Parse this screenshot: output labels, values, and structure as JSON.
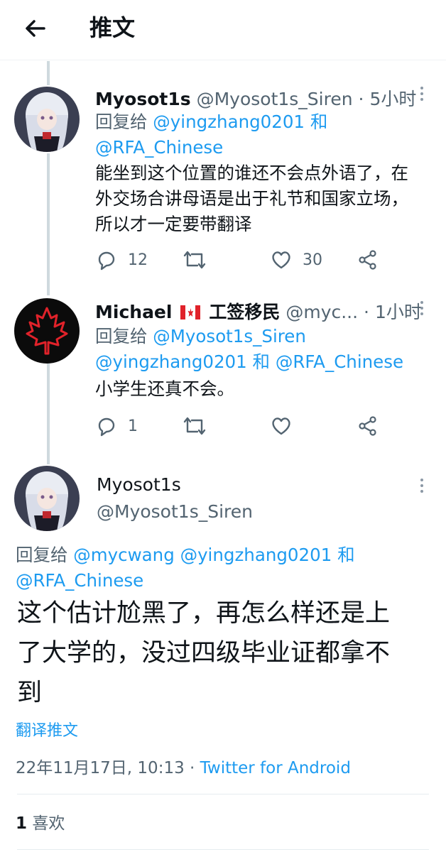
{
  "header": {
    "title": "推文"
  },
  "replies": [
    {
      "display_name": "Myosot1s",
      "handle": "@Myosot1s_Siren",
      "time": "5小时",
      "reply_prefix": "回复给",
      "reply_user_1": "@yingzhang0201",
      "reply_and": "和",
      "reply_user_2": "@RFA_Chinese",
      "text_lines": [
        "能坐到这个位置的谁还不会点外语了，在",
        "外交场合讲母语是出于礼节和国家立场，",
        "所以才一定要带翻译"
      ],
      "reply_count": "12",
      "like_count": "30"
    },
    {
      "display_name": "Michael",
      "name_suffix": "工签移民",
      "handle": "@myc...",
      "time": "1小时",
      "reply_prefix": "回复给",
      "reply_user_1": "@Myosot1s_Siren",
      "reply_user_2": "@yingzhang0201",
      "reply_and": "和",
      "reply_user_3": "@RFA_Chinese",
      "text_lines": [
        "小学生还真不会。"
      ],
      "reply_count": "1"
    }
  ],
  "main_tweet": {
    "display_name": "Myosot1s",
    "handle": "@Myosot1s_Siren",
    "reply_prefix": "回复给",
    "reply_user_1": "@mycwang",
    "reply_user_2": "@yingzhang0201",
    "reply_and": "和",
    "reply_user_3": "@RFA_Chinese",
    "text_lines": [
      "这个估计尬黑了，再怎么样还是上",
      "了大学的，没过四级毕业证都拿不",
      "到"
    ],
    "translate": "翻译推文",
    "timestamp": "22年11月17日, 10:13",
    "separator": "·",
    "source": "Twitter for Android",
    "likes_count": "1",
    "likes_label": "喜欢"
  },
  "colors": {
    "link": "#1d9bf0",
    "muted": "#536471",
    "text": "#0f1419",
    "line": "#cfd9de"
  }
}
